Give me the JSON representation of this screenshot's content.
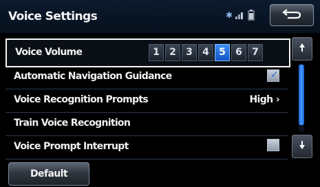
{
  "header": {
    "title": "Voice Settings",
    "icons": [
      "bluetooth-icon",
      "signal-icon",
      "battery-icon",
      "back-arrow-icon"
    ]
  },
  "settings": {
    "rows": [
      {
        "label": "Voice Volume"
      },
      {
        "label": "Automatic Navigation Guidance",
        "checked": true
      },
      {
        "label": "Voice Recognition Prompts",
        "value": "High ›"
      },
      {
        "label": "Train Voice Recognition"
      },
      {
        "label": "Voice Prompt Interrupt",
        "checked": false
      }
    ],
    "volume_levels": [
      "1",
      "2",
      "3",
      "4",
      "5",
      "6",
      "7"
    ],
    "volume_selected": "5"
  },
  "scroll": {
    "up_icon": "up-arrow-icon",
    "down_icon": "down-arrow-icon",
    "position": 0.0
  },
  "footer": {
    "default_label": "Default"
  },
  "colors": {
    "accent": "#1e6be0",
    "background": "#000000",
    "text": "#f2f2f2"
  }
}
